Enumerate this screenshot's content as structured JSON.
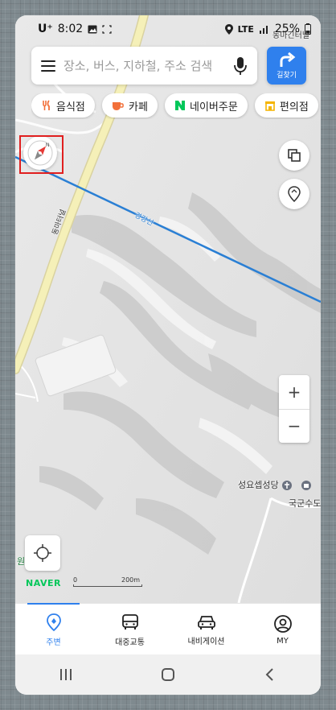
{
  "status_bar": {
    "carrier": "U⁺",
    "time": "8:02",
    "network": "LTE",
    "battery": "25%"
  },
  "search": {
    "placeholder": "장소, 버스, 지하철, 주소 검색"
  },
  "route_button": {
    "label": "길찾기"
  },
  "categories": [
    {
      "label": "음식점",
      "icon": "fork-knife-icon",
      "color": "#f2703a"
    },
    {
      "label": "카페",
      "icon": "coffee-cup-icon",
      "color": "#f2703a"
    },
    {
      "label": "네이버주문",
      "icon": "naver-n-icon",
      "color": "#03c75a"
    },
    {
      "label": "편의점",
      "icon": "store-icon",
      "color": "#f5b400"
    }
  ],
  "map": {
    "labels": {
      "road_top": "동마긴터널",
      "road_vertical": "동마터널",
      "rail": "경강선",
      "place_church": "성요셉성당",
      "place_national": "국군수도",
      "place_left": "원"
    },
    "zoom_in": "+",
    "zoom_out": "−",
    "scale": {
      "zero": "0",
      "distance": "200m"
    },
    "logo": "NAVER"
  },
  "bottom_nav": [
    {
      "label": "주변",
      "icon": "location-pin-icon",
      "active": true
    },
    {
      "label": "대중교통",
      "icon": "bus-icon",
      "active": false
    },
    {
      "label": "내비게이션",
      "icon": "car-icon",
      "active": false
    },
    {
      "label": "MY",
      "icon": "profile-icon",
      "active": false
    }
  ],
  "colors": {
    "accent": "#2f80ed",
    "naver_green": "#03c75a",
    "rail_line": "#2a7fd4",
    "road": "#f5f0b8",
    "highlight": "#e01f1f"
  }
}
